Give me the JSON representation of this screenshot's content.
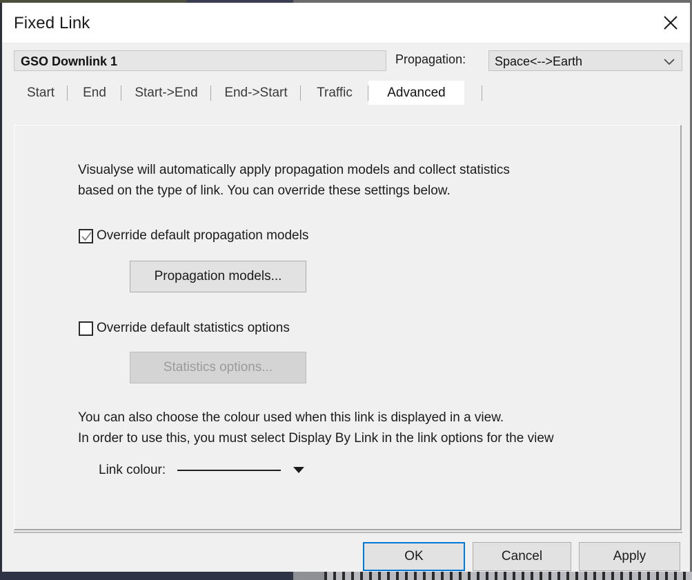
{
  "window": {
    "title": "Fixed Link",
    "close_icon": "close-x-icon"
  },
  "header": {
    "link_name": "GSO Downlink 1",
    "propagation_label": "Propagation:",
    "propagation_value": "Space<-->Earth",
    "propagation_chevron_icon": "chevron-down-icon"
  },
  "tabs": [
    {
      "label": "Start",
      "active": false
    },
    {
      "label": "End",
      "active": false
    },
    {
      "label": "Start->End",
      "active": false
    },
    {
      "label": "End->Start",
      "active": false
    },
    {
      "label": "Traffic",
      "active": false
    },
    {
      "label": "Advanced",
      "active": true
    }
  ],
  "advanced": {
    "intro_line1": "Visualyse will automatically apply propagation models and collect statistics",
    "intro_line2": "based on the type of link. You can override these settings below.",
    "override_propagation_label": "Override default propagation models",
    "override_propagation_checked": true,
    "propagation_models_button": "Propagation models...",
    "override_statistics_label": "Override default statistics options",
    "override_statistics_checked": false,
    "statistics_options_button": "Statistics options...",
    "statistics_options_disabled": true,
    "colour_line1": "You can also choose the colour used when this link is displayed in a view.",
    "colour_line2": "In order to use this, you must select Display By Link in the link options for the view",
    "link_colour_label": "Link colour:",
    "link_colour_value": "#1e1e1e",
    "link_colour_caret_icon": "caret-down-icon"
  },
  "footer": {
    "ok_label": "OK",
    "cancel_label": "Cancel",
    "apply_label": "Apply",
    "focus_colour": "#0078d7"
  }
}
